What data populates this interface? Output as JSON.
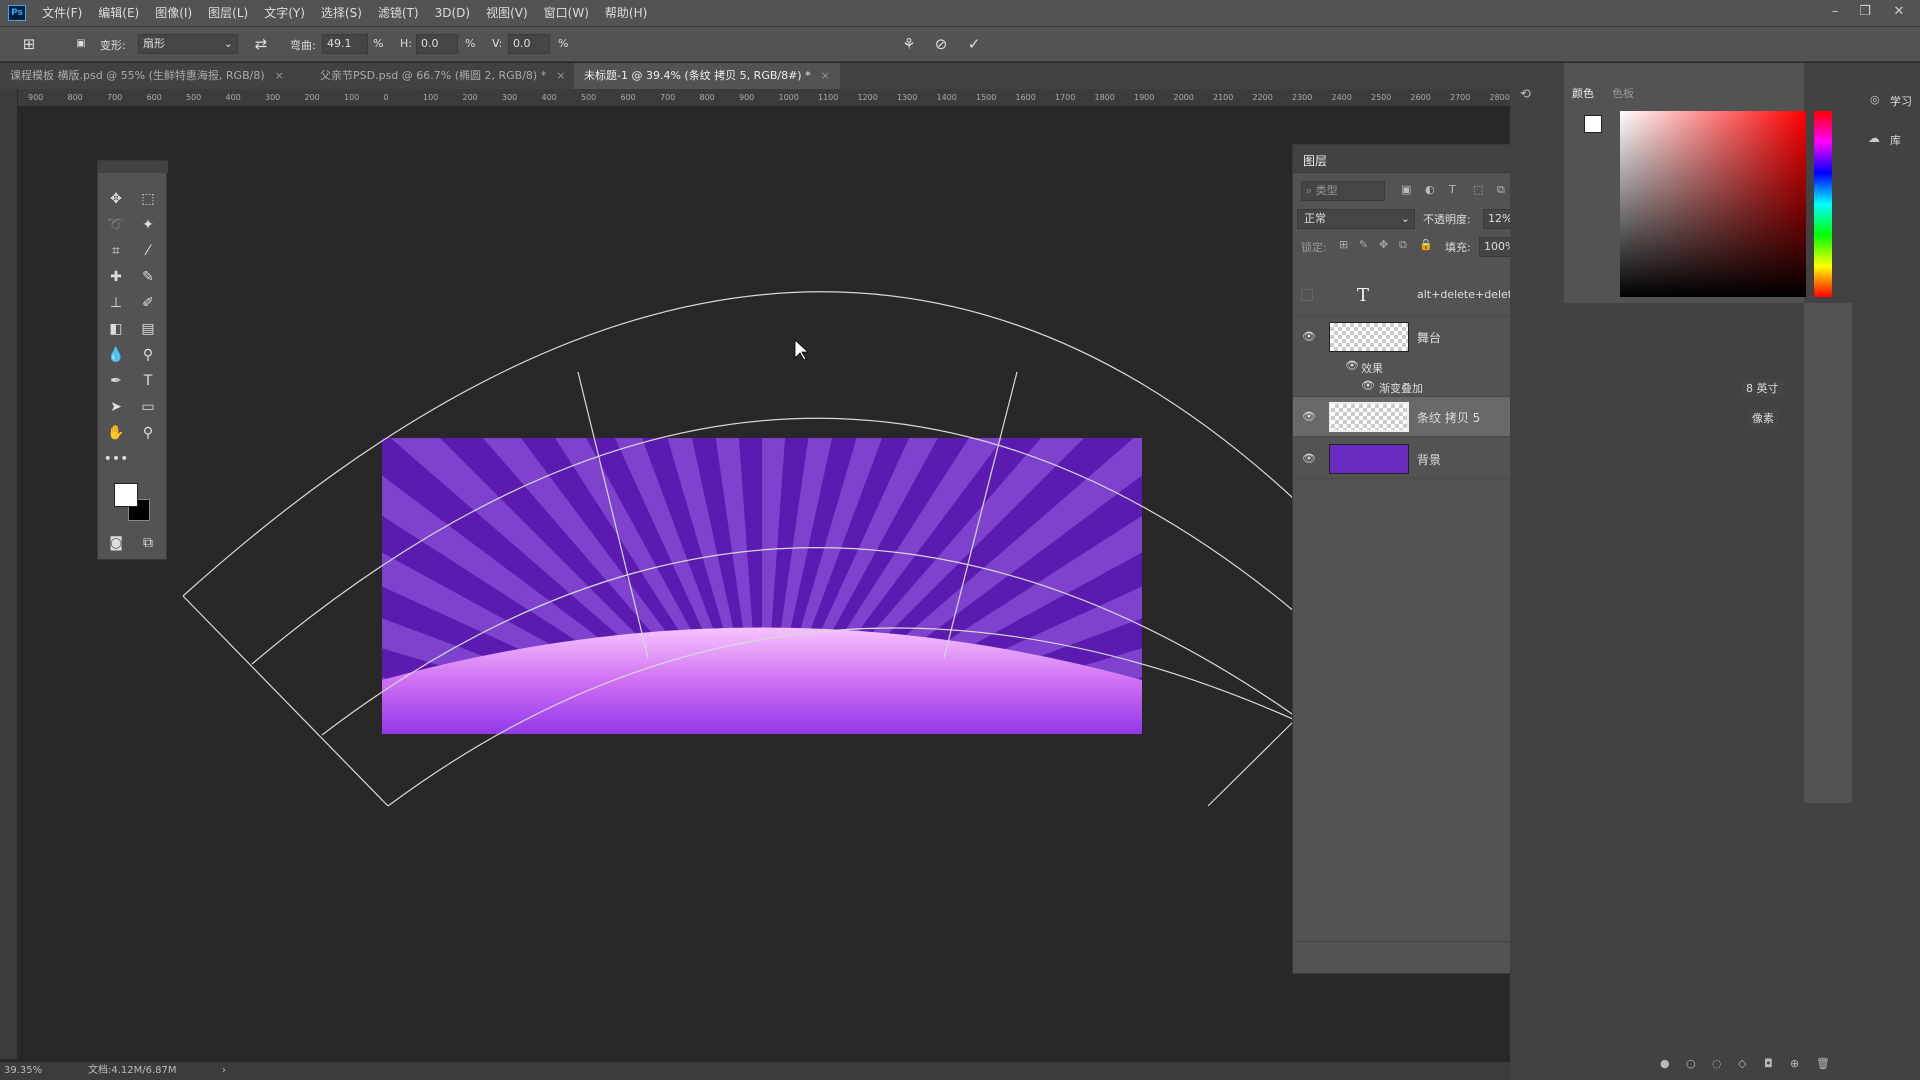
{
  "app": {
    "logo": "Ps"
  },
  "menu": [
    "文件(F)",
    "编辑(E)",
    "图像(I)",
    "图层(L)",
    "文字(Y)",
    "选择(S)",
    "滤镜(T)",
    "3D(D)",
    "视图(V)",
    "窗口(W)",
    "帮助(H)"
  ],
  "window_controls": {
    "minimize": "–",
    "restore": "❐",
    "close": "✕"
  },
  "options_bar": {
    "warp_label": "变形:",
    "warp_value": "扇形",
    "bend_label": "弯曲:",
    "bend_value": "49.1",
    "bend_unit": "%",
    "h_label": "H:",
    "h_value": "0.0",
    "h_unit": "%",
    "v_label": "V:",
    "v_value": "0.0",
    "v_unit": "%"
  },
  "doc_tabs": [
    {
      "label": "课程模板 横版.psd @ 55% (生鲜特惠海报, RGB/8)",
      "active": false
    },
    {
      "label": "父亲节PSD.psd @ 66.7% (椭圆 2, RGB/8) *",
      "active": false
    },
    {
      "label": "未标题-1 @ 39.4% (条纹 拷贝 5, RGB/8#) *",
      "active": true
    }
  ],
  "ruler_marks": [
    "900",
    "800",
    "700",
    "600",
    "500",
    "400",
    "300",
    "200",
    "100",
    "0",
    "100",
    "200",
    "300",
    "400",
    "500",
    "600",
    "700",
    "800",
    "900",
    "1000",
    "1100",
    "1200",
    "1300",
    "1400",
    "1500",
    "1600",
    "1700",
    "1800",
    "1900",
    "2000",
    "2100",
    "2200",
    "2300",
    "2400",
    "2500",
    "2600",
    "2700",
    "2800"
  ],
  "status": {
    "zoom": "39.35%",
    "doc_info": "文档:4.12M/6.87M"
  },
  "layers_panel": {
    "title": "图层",
    "search_placeholder": "类型",
    "blend_mode": "正常",
    "opacity_label": "不透明度:",
    "opacity_value": "12%",
    "lock_label": "锁定:",
    "fill_label": "填充:",
    "fill_value": "100%",
    "layers": [
      {
        "name": "alt+delete+delete",
        "type": "text"
      },
      {
        "name": "舞台",
        "fx": "fx",
        "effects_label": "效果",
        "effect": "渐变叠加"
      },
      {
        "name": "条纹 拷贝 5",
        "selected": true
      },
      {
        "name": "背景",
        "locked": true,
        "color": "#6a2bc2"
      }
    ]
  },
  "color_panel": {
    "tab1": "颜色",
    "tab2": "色板"
  },
  "right_labels": {
    "learn": "学习",
    "library": "库",
    "inch": "8 英寸",
    "pixel": "像素"
  },
  "colors": {
    "purple_dark": "#5b1bb0",
    "purple_stripe": "#8a4fd8",
    "pink_top": "#f4b4ff",
    "pink_bottom": "#9b3ff0"
  }
}
